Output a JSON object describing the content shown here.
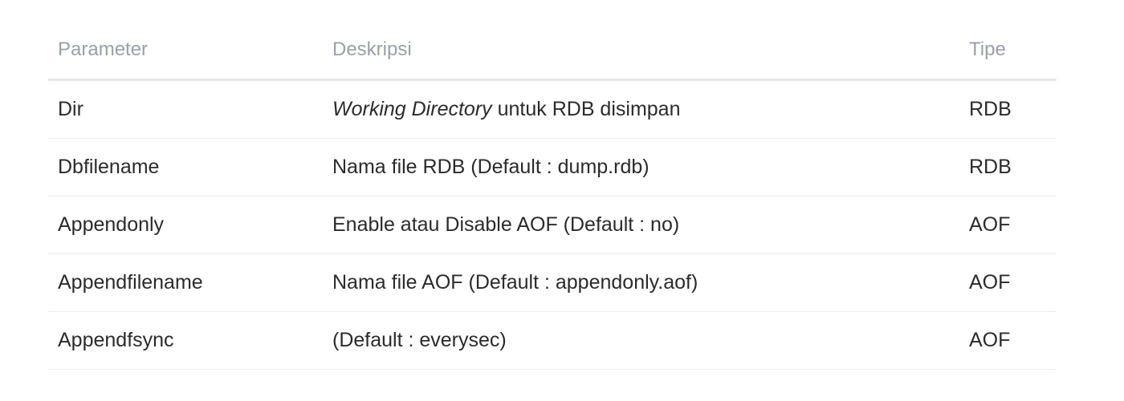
{
  "table": {
    "headers": [
      "Parameter",
      "Deskripsi",
      "Tipe"
    ],
    "rows": [
      {
        "parameter": "Dir",
        "description_italic": "Working Directory",
        "description": " untuk RDB disimpan",
        "type": "RDB"
      },
      {
        "parameter": "Dbfilename",
        "description_italic": "",
        "description": "Nama file RDB (Default : dump.rdb)",
        "type": "RDB"
      },
      {
        "parameter": "Appendonly",
        "description_italic": "",
        "description": "Enable atau Disable AOF (Default : no)",
        "type": "AOF"
      },
      {
        "parameter": "Appendfilename",
        "description_italic": "",
        "description": "Nama file AOF (Default : appendonly.aof)",
        "type": "AOF"
      },
      {
        "parameter": "Appendfsync",
        "description_italic": "",
        "description": "(Default : everysec)",
        "type": "AOF"
      }
    ]
  }
}
